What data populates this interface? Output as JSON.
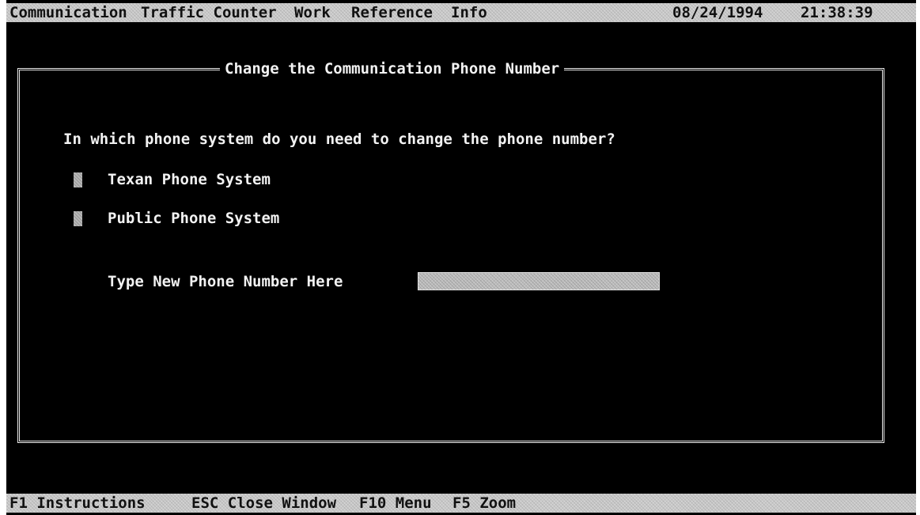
{
  "menu_bar": {
    "items": [
      "Communication",
      "Traffic Counter",
      "Work",
      "Reference",
      "Info"
    ],
    "date": "08/24/1994",
    "time": "21:38:39"
  },
  "dialog": {
    "title": "Change the Communication Phone Number",
    "question": "In which phone system do you need to change the phone number?",
    "options": [
      "Texan Phone System",
      "Public Phone System"
    ],
    "phone_field_label": "Type New Phone Number Here",
    "phone_field_value": ""
  },
  "status_bar": {
    "items": [
      "F1 Instructions",
      "ESC Close Window",
      "F10 Menu",
      "F5 Zoom"
    ]
  },
  "colors": {
    "background": "#000000",
    "text": "#f2f2f2",
    "bar": "#c9c9c9",
    "bar_text": "#111111"
  }
}
